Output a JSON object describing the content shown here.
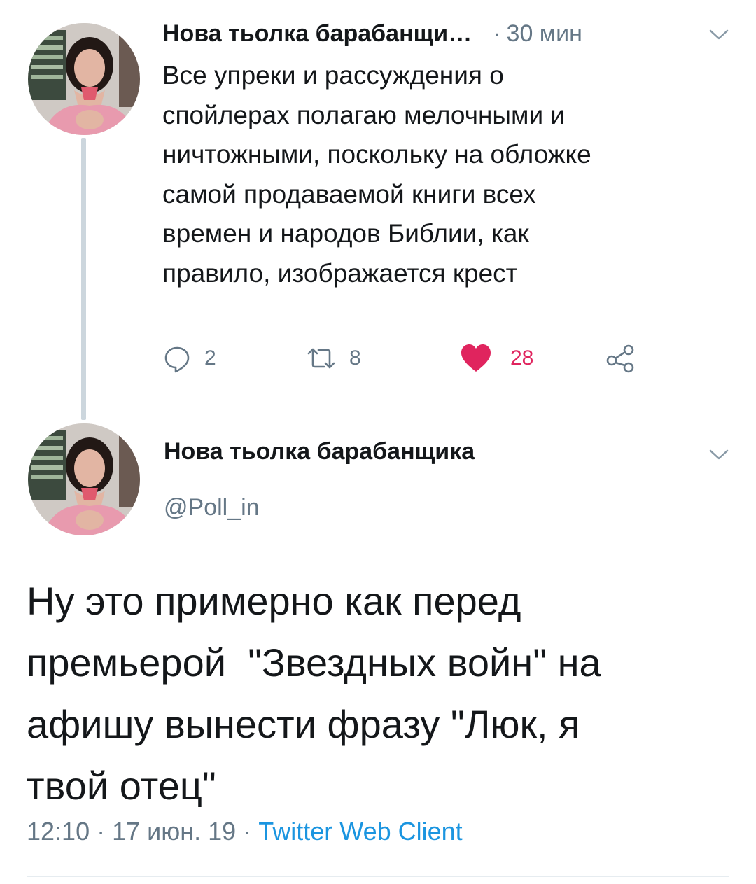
{
  "parent_tweet": {
    "author_name": "Нова тьолка барабанщи",
    "name_ellipsis": "…",
    "separator": "·",
    "time_ago": "30 мин",
    "text_lines": [
      "Все упреки и рассуждения о",
      "спойлерах полагаю мелочными и",
      "ничтожными, поскольку на обложке",
      "самой продаваемой книги всех",
      "времен и народов Библии, как",
      "правило, изображается крест"
    ],
    "actions": {
      "replies": "2",
      "retweets": "8",
      "likes": "28"
    },
    "icons": {
      "reply": "reply-icon",
      "retweet": "retweet-icon",
      "like": "heart-icon",
      "share": "share-icon",
      "menu": "chevron-down-icon"
    }
  },
  "focused_tweet": {
    "author_name": "Нова тьолка барабанщика",
    "handle": "@Poll_in",
    "text_lines": [
      "Ну это примерно как перед",
      "премьерой  \"Звездных войн\" на",
      "афишу вынести фразу \"Люк, я",
      "твой отец\""
    ],
    "time": "12:10",
    "date": "17 июн. 19",
    "separator": "·",
    "client": "Twitter Web Client"
  },
  "colors": {
    "text": "#14171a",
    "secondary": "#657786",
    "like": "#e0245e",
    "link": "#1b95e0",
    "thread_line": "#ccd6dd"
  }
}
